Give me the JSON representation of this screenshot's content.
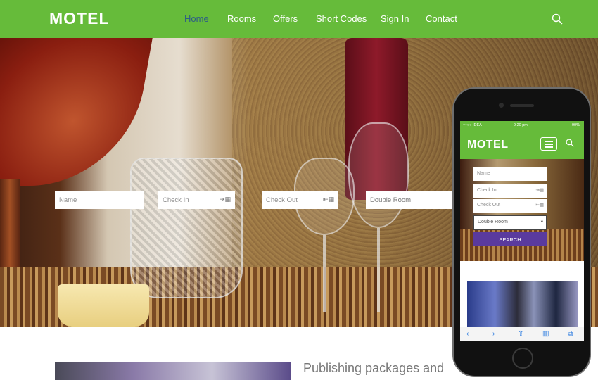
{
  "brand": {
    "logo": "MOTEL",
    "accent": "#66bb3a",
    "active_color": "#2e5d86",
    "button_color": "#5a3a9e"
  },
  "nav": {
    "items": [
      {
        "label": "Home",
        "active": true
      },
      {
        "label": "Rooms",
        "active": false
      },
      {
        "label": "Offers",
        "active": false
      },
      {
        "label": "Short Codes",
        "active": false
      },
      {
        "label": "Sign In",
        "active": false
      },
      {
        "label": "Contact",
        "active": false
      }
    ],
    "search_icon": "search-icon"
  },
  "booking": {
    "name_placeholder": "Name",
    "checkin_placeholder": "Check In",
    "checkout_placeholder": "Check Out",
    "room_value": "Double Room"
  },
  "section": {
    "title": "Publishing packages and"
  },
  "phone": {
    "status": {
      "carrier": "•••○○ IDEA",
      "time": "9:20 pm",
      "battery": "90%"
    },
    "logo": "MOTEL",
    "booking": {
      "name_placeholder": "Name",
      "checkin_placeholder": "Check In",
      "checkout_placeholder": "Check Out",
      "room_value": "Double Room",
      "search_label": "SEARCH"
    },
    "toolbar": [
      "back-icon",
      "forward-icon",
      "share-icon",
      "bookmarks-icon",
      "tabs-icon"
    ]
  }
}
